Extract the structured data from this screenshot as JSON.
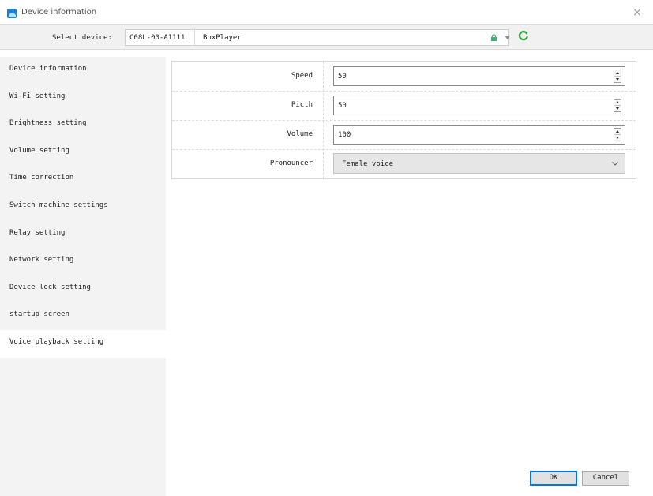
{
  "window": {
    "title": "Device information",
    "close_glyph": "×"
  },
  "device_bar": {
    "label": "Select device:",
    "device_id": "C08L-00-A1111",
    "device_name": "BoxPlayer",
    "icons": [
      "lock-icon",
      "chevron-down-icon",
      "refresh-icon"
    ],
    "lock_color": "#3cb371",
    "refresh_color": "#2ea43a"
  },
  "sidebar": {
    "items": [
      {
        "label": "Device information"
      },
      {
        "label": "Wi-Fi setting"
      },
      {
        "label": "Brightness setting"
      },
      {
        "label": "Volume setting"
      },
      {
        "label": "Time correction"
      },
      {
        "label": "Switch machine settings"
      },
      {
        "label": "Relay setting"
      },
      {
        "label": "Network setting"
      },
      {
        "label": "Device lock setting"
      },
      {
        "label": "startup screen"
      },
      {
        "label": "Voice playback setting"
      }
    ],
    "active_label": "Voice playback setting"
  },
  "form": {
    "speed": {
      "label": "Speed",
      "value": "50"
    },
    "pitch": {
      "label": "Picth",
      "value": "50"
    },
    "volume": {
      "label": "Volume",
      "value": "100"
    },
    "pronouncer": {
      "label": "Pronouncer",
      "selected": "Female voice"
    }
  },
  "footer": {
    "ok_label": "OK",
    "cancel_label": "Cancel"
  }
}
